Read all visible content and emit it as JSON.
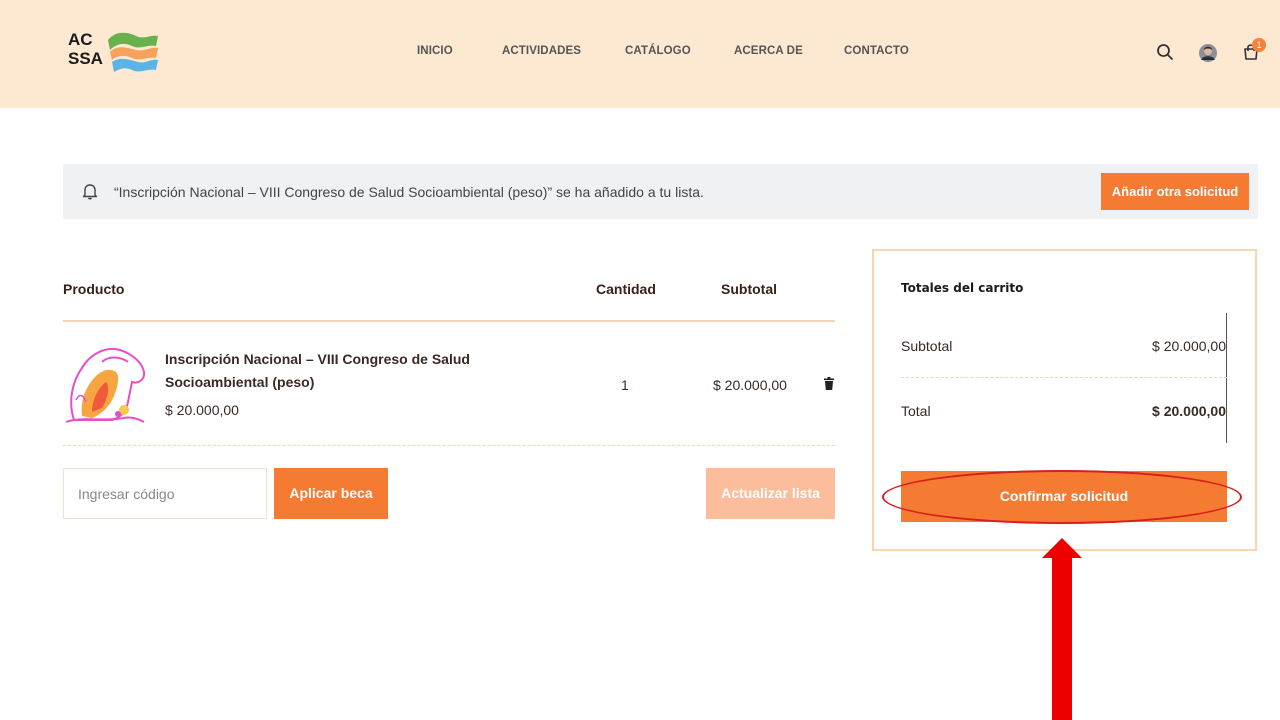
{
  "header": {
    "logo": {
      "line1": "AC",
      "line2": "SSA"
    },
    "nav": [
      {
        "label": "INICIO"
      },
      {
        "label": "ACTIVIDADES"
      },
      {
        "label": "CATÁLOGO"
      },
      {
        "label": "ACERCA DE"
      },
      {
        "label": "CONTACTO"
      }
    ],
    "icons": [
      "search-icon",
      "avatar",
      "cart-icon"
    ],
    "cart_count": "1"
  },
  "notice": {
    "message": "“Inscripción Nacional – VIII Congreso de Salud Socioambiental (peso)” se ha añadido a tu lista.",
    "button": "Añadir otra solicitud",
    "icon": "bell-icon"
  },
  "cart_table": {
    "headers": {
      "product": "Producto",
      "quantity": "Cantidad",
      "subtotal": "Subtotal"
    },
    "items": [
      {
        "name": "Inscripción Nacional – VIII Congreso de Salud Socioambiental (peso)",
        "price": "$ 20.000,00",
        "quantity": "1",
        "subtotal": "$ 20.000,00"
      }
    ]
  },
  "coupon": {
    "placeholder": "Ingresar código",
    "apply_label": "Aplicar beca",
    "update_label": "Actualizar lista"
  },
  "totals": {
    "title": "Totales del carrito",
    "subtotal_label": "Subtotal",
    "subtotal_value": "$ 20.000,00",
    "total_label": "Total",
    "total_value": "$ 20.000,00",
    "confirm_label": "Confirmar solicitud"
  },
  "colors": {
    "header_bg": "#fde8d2",
    "accent": "#f57a32",
    "annotation": "#e00000"
  }
}
